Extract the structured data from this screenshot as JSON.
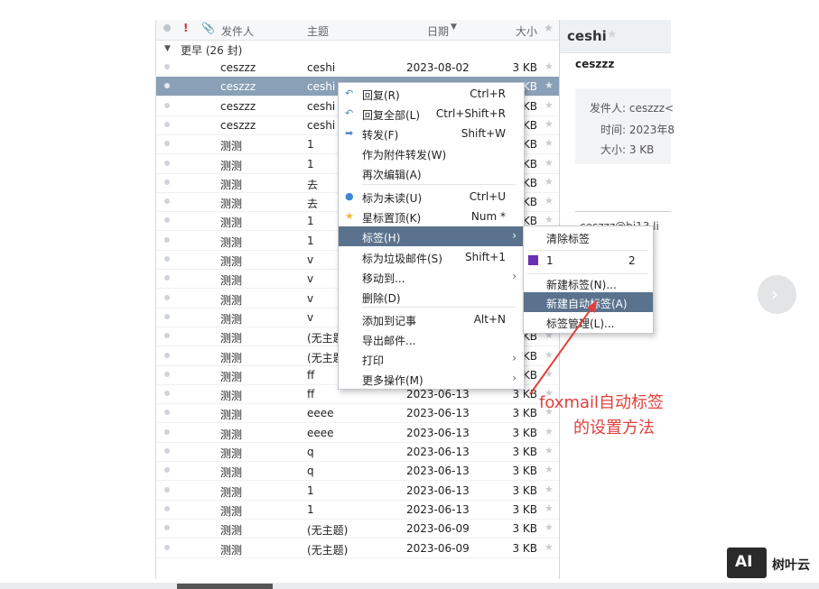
{
  "list": {
    "headers": {
      "sender": "发件人",
      "subject": "主题",
      "date": "日期",
      "size": "大小"
    },
    "group": "更早 (26 封)",
    "rows": [
      {
        "sender": "ceszzz",
        "subject": "ceshi",
        "date": "2023-08-02",
        "size": "3 KB"
      },
      {
        "sender": "ceszzz",
        "subject": "ceshi",
        "date": "",
        "size": "KB"
      },
      {
        "sender": "ceszzz",
        "subject": "ceshi",
        "date": "",
        "size": "KB"
      },
      {
        "sender": "ceszzz",
        "subject": "ceshi",
        "date": "",
        "size": "KB"
      },
      {
        "sender": "测测",
        "subject": "1",
        "date": "",
        "size": "KB"
      },
      {
        "sender": "测测",
        "subject": "1",
        "date": "",
        "size": "KB"
      },
      {
        "sender": "测测",
        "subject": "去",
        "date": "",
        "size": "KB"
      },
      {
        "sender": "测测",
        "subject": "去",
        "date": "",
        "size": "KB"
      },
      {
        "sender": "测测",
        "subject": "1",
        "date": "",
        "size": "KB"
      },
      {
        "sender": "测测",
        "subject": "1",
        "date": "",
        "size": "KB"
      },
      {
        "sender": "测测",
        "subject": "v",
        "date": "",
        "size": "KB"
      },
      {
        "sender": "测测",
        "subject": "v",
        "date": "",
        "size": "KB"
      },
      {
        "sender": "测测",
        "subject": "v",
        "date": "",
        "size": "KB"
      },
      {
        "sender": "测测",
        "subject": "v",
        "date": "",
        "size": "KB"
      },
      {
        "sender": "测测",
        "subject": "(无主题",
        "date": "",
        "size": "KB"
      },
      {
        "sender": "测测",
        "subject": "(无主题",
        "date": "",
        "size": "KB"
      },
      {
        "sender": "测测",
        "subject": "ff",
        "date": "",
        "size": "KB"
      },
      {
        "sender": "测测",
        "subject": "ff",
        "date": "2023-06-13",
        "size": "3 KB"
      },
      {
        "sender": "测测",
        "subject": "eeee",
        "date": "2023-06-13",
        "size": "3 KB"
      },
      {
        "sender": "测测",
        "subject": "eeee",
        "date": "2023-06-13",
        "size": "3 KB"
      },
      {
        "sender": "测测",
        "subject": "q",
        "date": "2023-06-13",
        "size": "3 KB"
      },
      {
        "sender": "测测",
        "subject": "q",
        "date": "2023-06-13",
        "size": "3 KB"
      },
      {
        "sender": "测测",
        "subject": "1",
        "date": "2023-06-13",
        "size": "3 KB"
      },
      {
        "sender": "测测",
        "subject": "1",
        "date": "2023-06-13",
        "size": "3 KB"
      },
      {
        "sender": "测测",
        "subject": "(无主题)",
        "date": "2023-06-09",
        "size": "3 KB"
      },
      {
        "sender": "测测",
        "subject": "(无主题)",
        "date": "2023-06-09",
        "size": "3 KB"
      }
    ]
  },
  "preview": {
    "title": "ceshi",
    "from_name": "ceszzz",
    "from_label": "发件人: ceszzz<",
    "time_label": "时间: 2023年8",
    "size_label": "大小: 3 KB",
    "addr": "ceszzz@bj13.li"
  },
  "context_menu": [
    {
      "label": "回复(R)",
      "shortcut": "Ctrl+R",
      "icon": "reply-icon"
    },
    {
      "label": "回复全部(L)",
      "shortcut": "Ctrl+Shift+R",
      "icon": "reply-all-icon"
    },
    {
      "label": "转发(F)",
      "shortcut": "Shift+W",
      "icon": "forward-icon"
    },
    {
      "label": "作为附件转发(W)",
      "shortcut": ""
    },
    {
      "label": "再次编辑(A)",
      "shortcut": ""
    },
    {
      "label": "标为未读(U)",
      "shortcut": "Ctrl+U",
      "icon": "unread-dot-icon"
    },
    {
      "label": "星标置顶(K)",
      "shortcut": "Num *",
      "icon": "star-icon"
    },
    {
      "label": "标签(H)",
      "shortcut": "",
      "submenu": true
    },
    {
      "label": "标为垃圾邮件(S)",
      "shortcut": "Shift+1"
    },
    {
      "label": "移动到...",
      "shortcut": "",
      "submenu": true
    },
    {
      "label": "删除(D)",
      "shortcut": ""
    },
    {
      "label": "添加到记事",
      "shortcut": "Alt+N"
    },
    {
      "label": "导出邮件...",
      "shortcut": ""
    },
    {
      "label": "打印",
      "shortcut": "",
      "submenu": true
    },
    {
      "label": "更多操作(M)",
      "shortcut": "",
      "submenu": true
    }
  ],
  "tag_submenu": {
    "clear": "清除标签",
    "tag_name": "1",
    "tag_num": "2",
    "tag_color": "#6a2fb5",
    "new_tag": "新建标签(N)...",
    "new_auto_tag": "新建自动标签(A)",
    "manage": "标签管理(L)..."
  },
  "annotation": {
    "line1": "foxmail自动标签",
    "line2": "的设置方法"
  },
  "logo": {
    "text": "树叶云",
    "mark": "AI"
  },
  "colors": {
    "accent": "#5a728d",
    "annotation": "#e0403c"
  }
}
